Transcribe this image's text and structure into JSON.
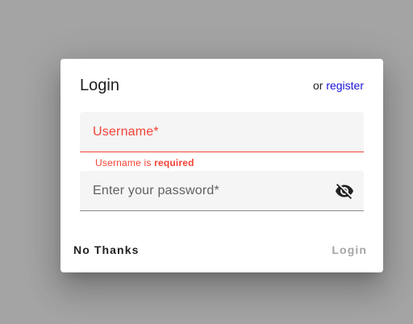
{
  "dialog": {
    "title": "Login",
    "register_prefix": "or ",
    "register_link": "register",
    "username": {
      "label": "Username*",
      "error_prefix": "Username is ",
      "error_emphasis": "required"
    },
    "password": {
      "label": "Enter your password*",
      "toggle_icon": "eye-off-icon"
    },
    "buttons": {
      "no_thanks": "No Thanks",
      "login": "Login"
    }
  },
  "colors": {
    "error": "#f44336",
    "link": "#1a13d6",
    "backdrop": "#a4a4a4"
  }
}
